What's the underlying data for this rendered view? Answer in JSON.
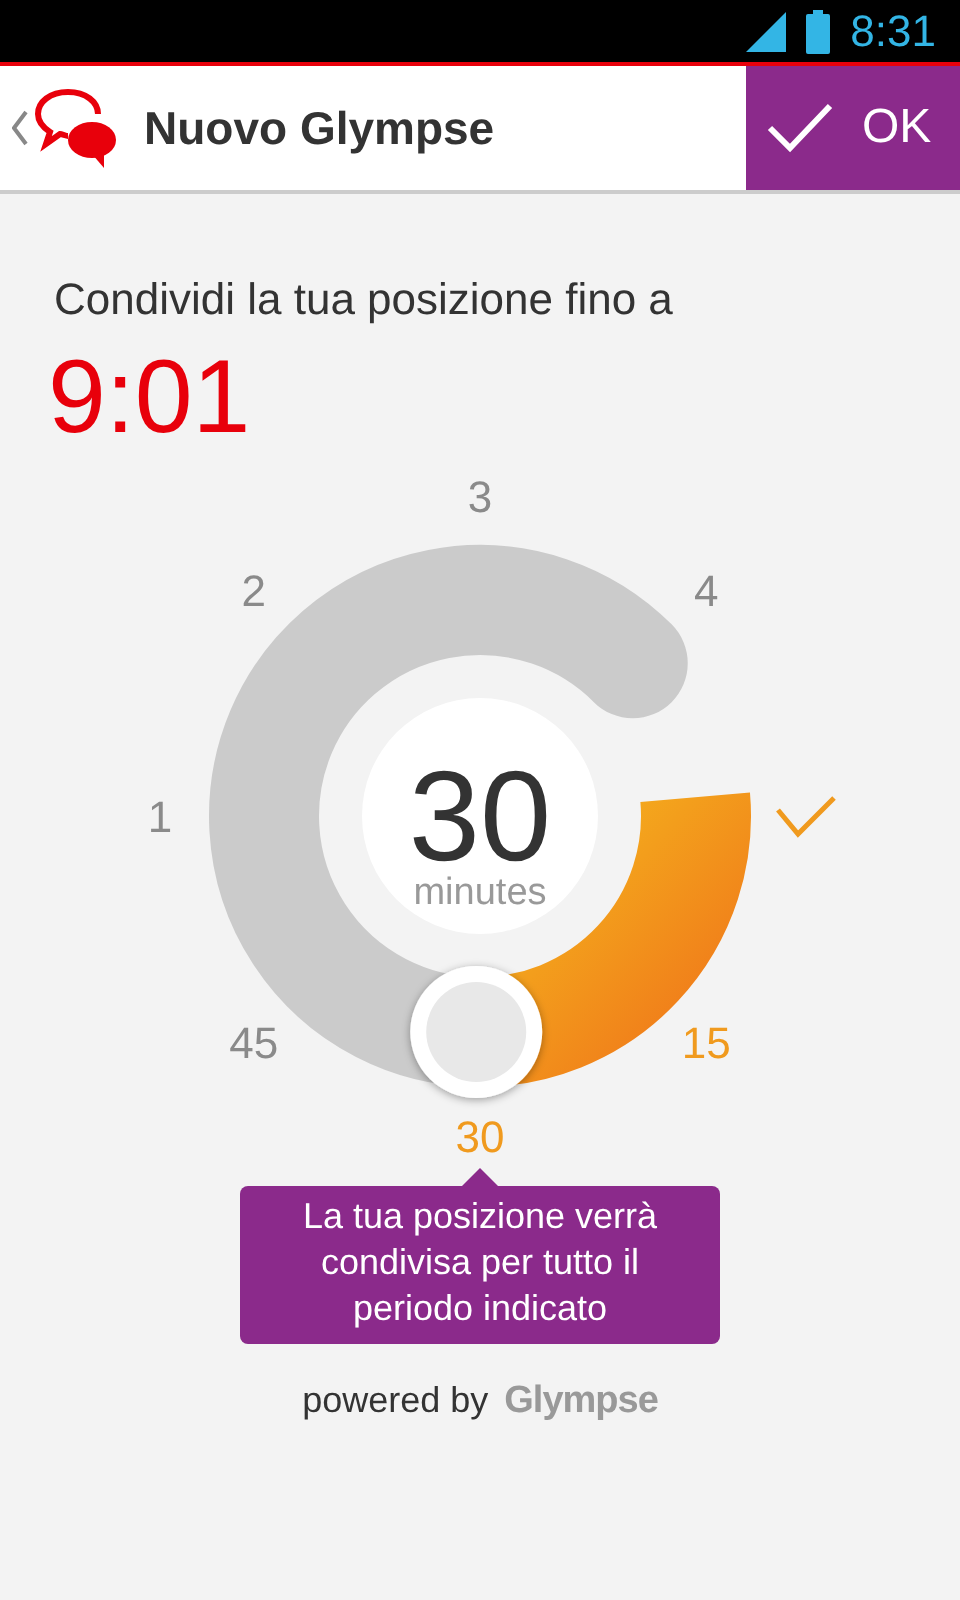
{
  "status_bar": {
    "time": "8:31"
  },
  "app_bar": {
    "title": "Nuovo Glympse",
    "ok_button": "OK"
  },
  "prompt": "Condividi la tua posizione fino a",
  "end_time": "9:01",
  "dial": {
    "value": "30",
    "unit": "minutes",
    "ticks": [
      {
        "label": "15",
        "active": true
      },
      {
        "label": "30",
        "active": true
      },
      {
        "label": "45",
        "active": false
      },
      {
        "label": "1",
        "active": false
      },
      {
        "label": "2",
        "active": false
      },
      {
        "label": "3",
        "active": false
      },
      {
        "label": "4",
        "active": false
      }
    ]
  },
  "tooltip": "La tua posizione verrà condivisa per tutto il periodo indicato",
  "footer": {
    "powered_by": "powered by",
    "brand": "Glympse"
  }
}
